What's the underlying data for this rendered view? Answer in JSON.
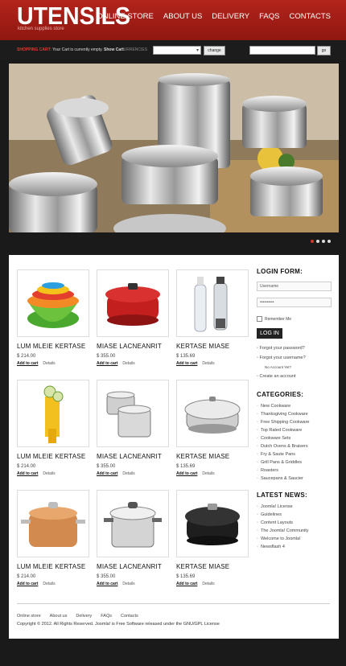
{
  "header": {
    "logo": "UTENSILS",
    "tagline": "kitchen supplies store",
    "nav": [
      "ONLINE STORE",
      "ABOUT US",
      "DELIVERY",
      "FAQS",
      "CONTACTS"
    ]
  },
  "bar": {
    "cart_label": "SHOPPING CART:",
    "cart_status": "Your Cart is currently empty.",
    "show_cart": "Show Cart",
    "currencies_label": "CURRENCIES",
    "change": "change",
    "go": "go"
  },
  "slider": {
    "slides": 4,
    "active": 0
  },
  "products": [
    {
      "name": "LUM MLEIE KERTASE",
      "price": "$ 214.00",
      "add": "Add to cart",
      "details": "Details",
      "icon": "nested-bowls-image"
    },
    {
      "name": "MIASE LACNEANRIT",
      "price": "$ 355.00",
      "add": "Add to cart",
      "details": "Details",
      "icon": "red-dutch-oven-image"
    },
    {
      "name": "KERTASE MIASE",
      "price": "$ 135.69",
      "add": "Add to cart",
      "details": "Details",
      "icon": "soda-bottles-image"
    },
    {
      "name": "LUM MLEIE KERTASE",
      "price": "$ 214.00",
      "add": "Add to cart",
      "details": "Details",
      "icon": "vegetable-slicer-image"
    },
    {
      "name": "MIASE LACNEANRIT",
      "price": "$ 355.00",
      "add": "Add to cart",
      "details": "Details",
      "icon": "steamer-pot-image"
    },
    {
      "name": "KERTASE MIASE",
      "price": "$ 135.69",
      "add": "Add to cart",
      "details": "Details",
      "icon": "stainless-casserole-image"
    },
    {
      "name": "LUM MLEIE KERTASE",
      "price": "$ 214.00",
      "add": "Add to cart",
      "details": "Details",
      "icon": "copper-pot-image"
    },
    {
      "name": "MIASE LACNEANRIT",
      "price": "$ 355.00",
      "add": "Add to cart",
      "details": "Details",
      "icon": "steel-stockpot-image"
    },
    {
      "name": "KERTASE MIASE",
      "price": "$ 135.69",
      "add": "Add to cart",
      "details": "Details",
      "icon": "black-dutch-oven-image"
    }
  ],
  "login": {
    "title": "LOGIN FORM:",
    "username": "Username",
    "password": "••••••••••",
    "remember": "Remember Me",
    "button": "LOG IN",
    "forgot_password": "Forgot your password?",
    "forgot_username": "Forgot your username?",
    "no_account": "No Account Yet?",
    "create": "Create an account"
  },
  "categories": {
    "title": "CATEGORIES:",
    "items": [
      "New Cookware",
      "Thanksgiving Cookware",
      "Free Shipping Cookware",
      "Top Rated Cookware",
      "Cookware Sets",
      "Dutch Ovens & Braisers",
      "Fry & Saute Pans",
      "Grill Pans & Griddles",
      "Roasters",
      "Saucepans & Saucier"
    ]
  },
  "news": {
    "title": "LATEST NEWS:",
    "items": [
      "Joomla! License",
      "Guidelines",
      "Content Layouts",
      "The Joomla! Community",
      "Welcome to Joomla!",
      "Newsflash 4"
    ]
  },
  "footer": {
    "nav": [
      "Online store",
      "About us",
      "Delivery",
      "FAQs",
      "Contacts"
    ],
    "copyright": "Copyright © 2012. All Rights Reserved. Joomla! is Free Software released under the GNU/GPL License"
  },
  "colors": {
    "brand": "#a51e16",
    "accent": "#e23b2e",
    "dark": "#1a1a1a"
  }
}
